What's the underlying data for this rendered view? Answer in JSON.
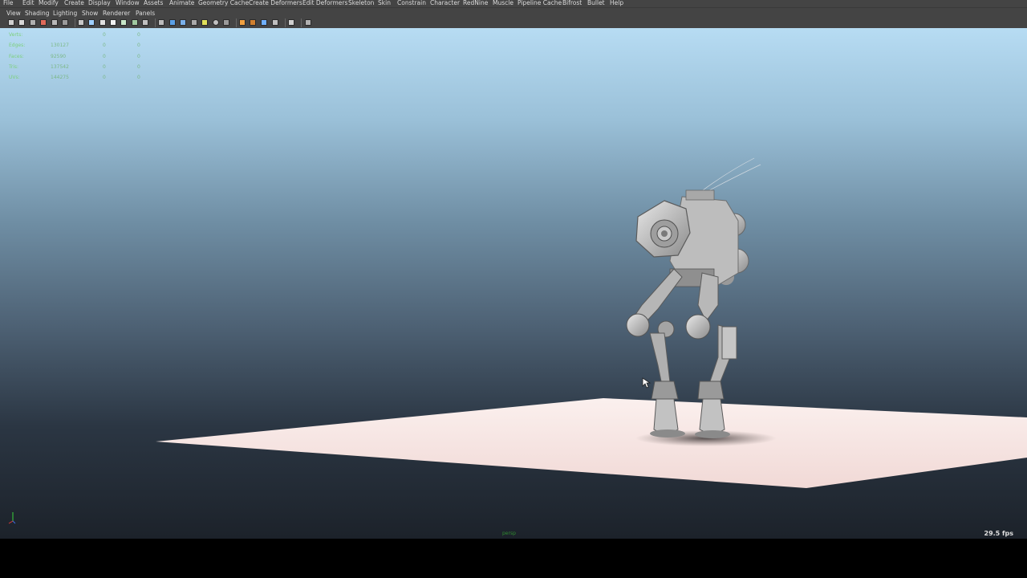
{
  "menu": [
    "File",
    "Edit",
    "Modify",
    "Create",
    "Display",
    "Window",
    "Assets",
    "Animate",
    "Geometry Cache",
    "Create Deformers",
    "Edit Deformers",
    "Skeleton",
    "Skin",
    "Constrain",
    "Character",
    "RedNine",
    "Muscle",
    "Pipeline Cache",
    "Bifrost",
    "Bullet",
    "Help"
  ],
  "panel_menu": [
    "View",
    "Shading",
    "Lighting",
    "Show",
    "Renderer",
    "Panels"
  ],
  "hud": {
    "rows": [
      {
        "label": "Verts:",
        "v1": "",
        "v2": "0",
        "v3": "0"
      },
      {
        "label": "Edges:",
        "v1": "130127",
        "v2": "0",
        "v3": "0"
      },
      {
        "label": "Faces:",
        "v1": "92590",
        "v2": "0",
        "v3": "0"
      },
      {
        "label": "Tris:",
        "v1": "137542",
        "v2": "0",
        "v3": "0"
      },
      {
        "label": "UVs:",
        "v1": "144275",
        "v2": "0",
        "v3": "0"
      }
    ]
  },
  "viewport": {
    "fps": "29.5 fps",
    "camera": "persp"
  },
  "colors": {
    "ui_bg": "#444444",
    "hud_text": "#7cd07c",
    "ground_plane": "#f6e4e1",
    "sky_top": "#b7dcf3",
    "sky_bottom": "#1c222a"
  },
  "toolbar_icons": [
    "select-camera-icon",
    "lock-camera-icon",
    "bookmark-icon",
    "image-plane-icon",
    "camera-attributes-icon",
    "grease-pencil-icon",
    "grid-icon",
    "film-gate-icon",
    "resolution-gate-icon",
    "gate-mask-icon",
    "field-chart-icon",
    "safe-action-icon",
    "safe-title-icon",
    "wireframe-icon",
    "smooth-shade-icon",
    "flat-shade-icon",
    "wireframe-on-shaded-icon",
    "xray-icon",
    "use-all-lights-icon",
    "shadows-icon",
    "ambient-occlusion-icon",
    "motion-blur-icon",
    "anti-alias-icon",
    "isolate-select-icon",
    "xray-joints-icon",
    "share-icon"
  ]
}
